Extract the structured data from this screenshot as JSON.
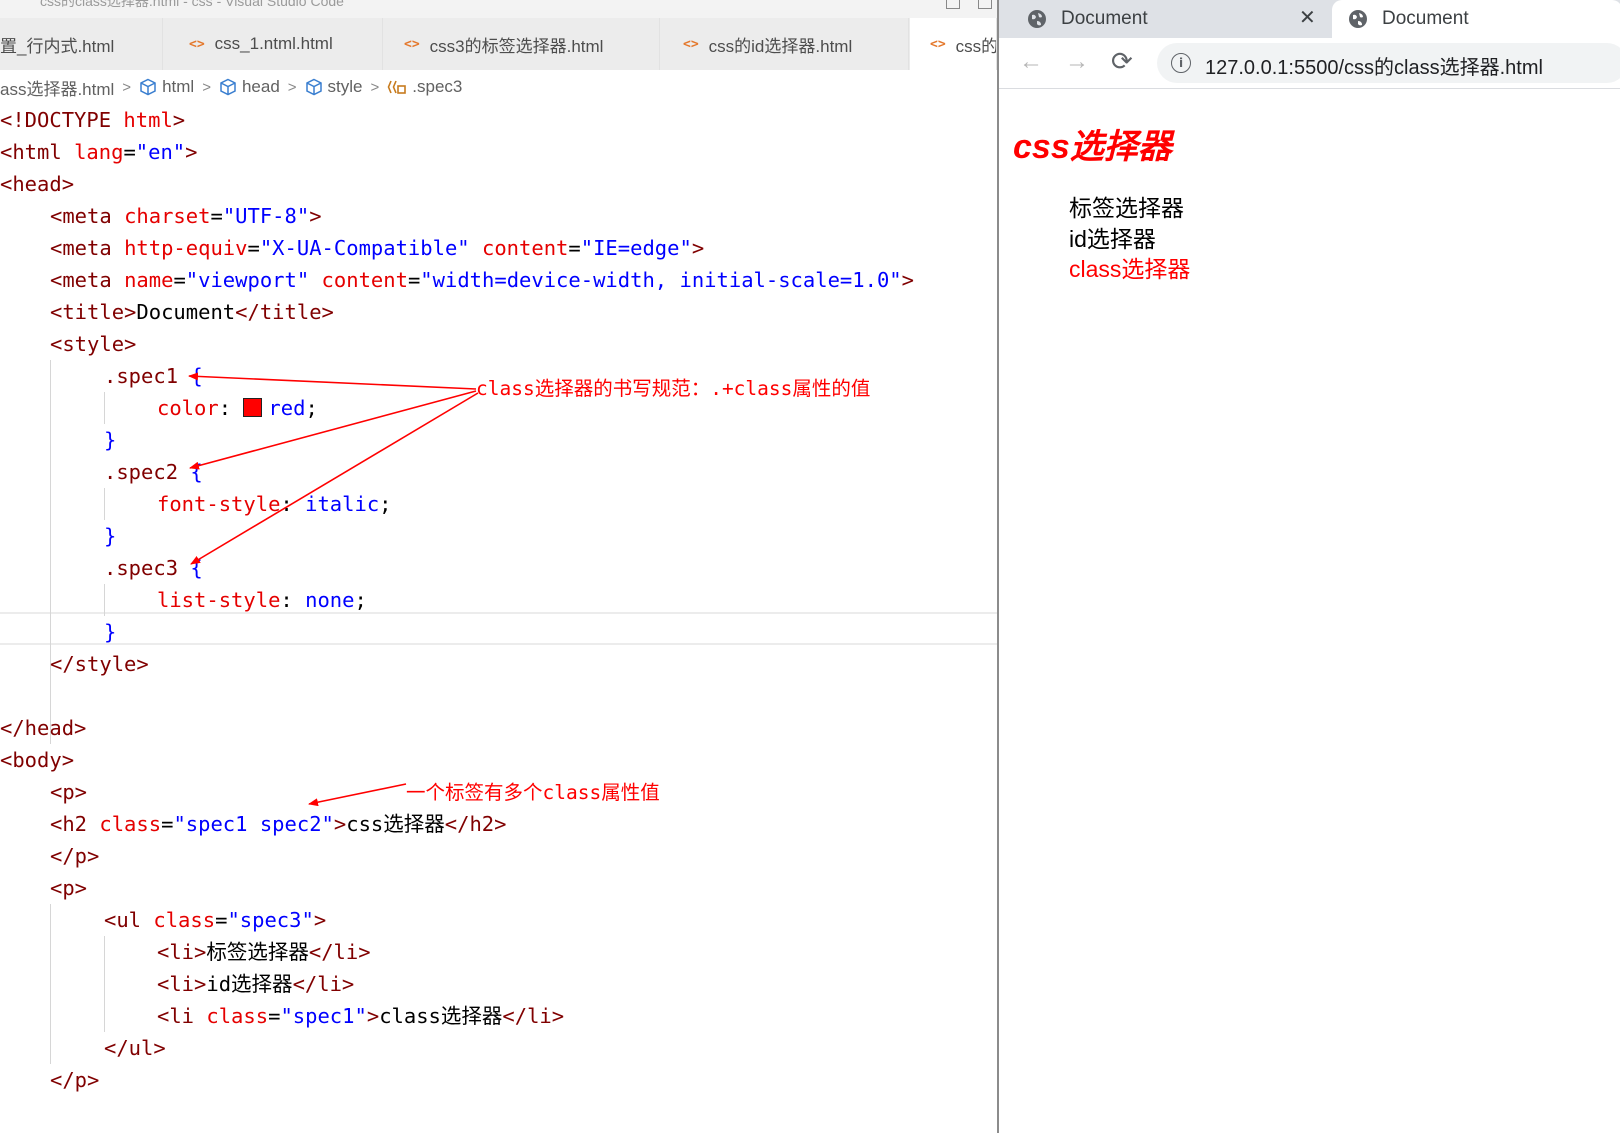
{
  "editor": {
    "window_title": "css的class选择器.html - css - Visual Studio Code",
    "tabs": [
      {
        "label": "置_行内式.html",
        "icon": "html-file-icon"
      },
      {
        "label": "css_1.ntml.html",
        "icon": "html-file-icon"
      },
      {
        "label": "css3的标签选择器.html",
        "icon": "html-file-icon"
      },
      {
        "label": "css的id选择器.html",
        "icon": "html-file-icon"
      },
      {
        "label": "css的",
        "icon": "html-file-icon"
      }
    ],
    "breadcrumb": [
      "ass选择器.html",
      "html",
      "head",
      "style",
      ".spec3"
    ],
    "code": {
      "l1": {
        "t1": "<!DOCTYPE ",
        "t2": "html",
        "t3": ">"
      },
      "l2": {
        "t1": "<html ",
        "a1": "lang",
        "e": "=",
        "v1": "\"en\"",
        "t2": ">"
      },
      "l3": {
        "t1": "<head>"
      },
      "l4": {
        "t1": "<meta ",
        "a1": "charset",
        "e": "=",
        "v1": "\"UTF-8\"",
        "t2": ">"
      },
      "l5": {
        "t1": "<meta ",
        "a1": "http-equiv",
        "e1": "=",
        "v1": "\"X-UA-Compatible\"",
        "a2": " content",
        "e2": "=",
        "v2": "\"IE=edge\"",
        "t2": ">"
      },
      "l6": {
        "t1": "<meta ",
        "a1": "name",
        "e1": "=",
        "v1": "\"viewport\"",
        "a2": " content",
        "e2": "=",
        "v2": "\"width=device-width, initial-scale=1.0\"",
        "t2": ">"
      },
      "l7": {
        "t1": "<title>",
        "x": "Document",
        "t2": "</title>"
      },
      "l8": {
        "t1": "<style>"
      },
      "l9": {
        "s": ".spec1 ",
        "b": "{"
      },
      "l10": {
        "p": "color",
        "c": ": ",
        "v": "red",
        "sc": ";"
      },
      "l11": {
        "b": "}"
      },
      "l12": {
        "s": ".spec2 ",
        "b": "{"
      },
      "l13": {
        "p": "font-style",
        "c": ": ",
        "v": "italic",
        "sc": ";"
      },
      "l14": {
        "b": "}"
      },
      "l15": {
        "s": ".spec3 ",
        "b": "{"
      },
      "l16": {
        "p": "list-style",
        "c": ": ",
        "v": "none",
        "sc": ";"
      },
      "l17": {
        "b": "}"
      },
      "l18": {
        "t1": "</style>"
      },
      "l20": {
        "t1": "</head>"
      },
      "l21": {
        "t1": "<body>"
      },
      "l22": {
        "t1": "<p>"
      },
      "l23": {
        "t1": "<h2 ",
        "a1": "class",
        "e": "=",
        "v1": "\"spec1 spec2\"",
        "t2": ">",
        "x": "css选择器",
        "t3": "</h2>"
      },
      "l24": {
        "t1": "</p>"
      },
      "l25": {
        "t1": "<p>"
      },
      "l26": {
        "t1": "<ul ",
        "a1": "class",
        "e": "=",
        "v1": "\"spec3\"",
        "t2": ">"
      },
      "l27": {
        "t1": "<li>",
        "x": "标签选择器",
        "t2": "</li>"
      },
      "l28": {
        "t1": "<li>",
        "x": "id选择器",
        "t2": "</li>"
      },
      "l29": {
        "t1": "<li ",
        "a1": "class",
        "e": "=",
        "v1": "\"spec1\"",
        "t2": ">",
        "x": "class选择器",
        "t3": "</li>"
      },
      "l30": {
        "t1": "</ul>"
      },
      "l31": {
        "t1": "</p>"
      }
    },
    "annotations": {
      "class_selector_rule": "class选择器的书写规范：.+class属性的值",
      "multi_class": "一个标签有多个class属性值"
    },
    "colors": {
      "annotation": "#ff0000",
      "tag": "#800000",
      "attr": "#e50000",
      "value": "#0000ff"
    }
  },
  "browser": {
    "tabs": [
      {
        "label": "Document",
        "icon": "globe-icon",
        "close": "✕"
      },
      {
        "label": "Document",
        "icon": "globe-icon"
      }
    ],
    "nav": {
      "back": "←",
      "forward": "→",
      "reload": "⟳"
    },
    "url": "127.0.0.1:5500/css的class选择器.html",
    "page": {
      "h2": "css选择器",
      "items": [
        "标签选择器",
        "id选择器",
        "class选择器"
      ]
    }
  }
}
